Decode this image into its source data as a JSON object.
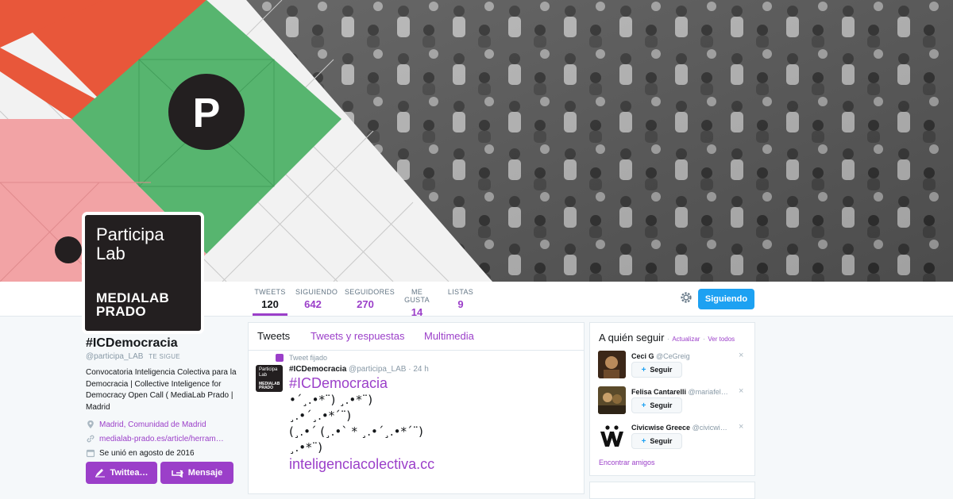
{
  "profile": {
    "avatar_line1": "Participa",
    "avatar_line2": "Lab",
    "avatar_brand1": "MEDIALAB",
    "avatar_brand2": "PRADO",
    "name": "#ICDemocracia",
    "handle": "@participa_LAB",
    "follows_you": "TE SIGUE",
    "bio": "Convocatoria Inteligencia Colectiva para la Democracia | Collective Inteligence for Democracy Open Call ( MediaLab Prado | Madrid",
    "location": "Madrid, Comunidad de Madrid",
    "url": "medialab-prado.es/article/herram…",
    "joined": "Se unió en agosto de 2016",
    "tweet_button": "Twittea…",
    "message_button": "Mensaje"
  },
  "banner": {
    "logo_letter": "P"
  },
  "stats": [
    {
      "label": "TWEETS",
      "value": "120"
    },
    {
      "label": "SIGUIENDO",
      "value": "642"
    },
    {
      "label": "SEGUIDORES",
      "value": "270"
    },
    {
      "label": "ME GUSTA",
      "value": "14"
    },
    {
      "label": "LISTAS",
      "value": "9"
    }
  ],
  "follow_button": "Siguiendo",
  "tabs": [
    "Tweets",
    "Tweets y respuestas",
    "Multimedia"
  ],
  "tweet": {
    "pinned_label": "Tweet fijado",
    "author_name": "#ICDemocracia",
    "author_handle": "@participa_LAB",
    "time": "24 h",
    "avatar_line1": "Participa",
    "avatar_line2": "Lab",
    "avatar_brand1": "MEDIALAB",
    "avatar_brand2": "PRADO",
    "hashtag": "#ICDemocracia",
    "art_line1": "•´¸.•*¨) ¸.•*¨)",
    "art_line2": "¸.•´¸.•*´¨)",
    "art_line3": "(¸.•´ (¸.•` * ¸.•´¸.•*´¨)",
    "art_line4": "¸.•*¨)",
    "link": "inteligenciacolectiva.cc"
  },
  "who_to_follow": {
    "title": "A quién seguir",
    "separator": "·",
    "refresh": "Actualizar",
    "view_all": "Ver todos",
    "follow_label": "Seguir",
    "close": "×",
    "find_friends": "Encontrar amigos",
    "suggestions": [
      {
        "name": "Ceci G",
        "handle": "@CeGreig"
      },
      {
        "name": "Felisa Cantarelli",
        "handle": "@mariafel…"
      },
      {
        "name": "Civicwise Greece",
        "handle": "@civicwi…"
      }
    ]
  },
  "colors": {
    "accent": "#9b3fc9",
    "follow_blue": "#1da1f2",
    "banner_orange": "#e8573a",
    "banner_green": "#57b56f",
    "banner_pink": "#f2a3a5"
  }
}
